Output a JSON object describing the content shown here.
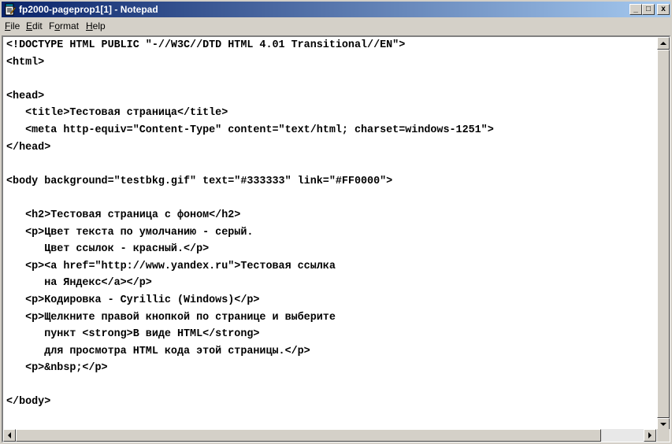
{
  "window": {
    "title": "fp2000-pageprop1[1] - Notepad",
    "caption_buttons": {
      "minimize": "_",
      "maximize": "□",
      "close": "x"
    }
  },
  "menu": [
    {
      "label": "File",
      "accel": "F",
      "rest": "ile"
    },
    {
      "label": "Edit",
      "accel": "E",
      "rest": "dit"
    },
    {
      "label": "Format",
      "accel": "o",
      "pre": "F",
      "rest": "rmat"
    },
    {
      "label": "Help",
      "accel": "H",
      "rest": "elp"
    }
  ],
  "editor": {
    "content": "<!DOCTYPE HTML PUBLIC \"-//W3C//DTD HTML 4.01 Transitional//EN\">\n<html>\n\n<head>\n   <title>Тестовая страница</title>\n   <meta http-equiv=\"Content-Type\" content=\"text/html; charset=windows-1251\">\n</head>\n\n<body background=\"testbkg.gif\" text=\"#333333\" link=\"#FF0000\">\n\n   <h2>Тестовая страница с фоном</h2>\n   <p>Цвет текста по умолчанию - серый.\n      Цвет ссылок - красный.</p>\n   <p><a href=\"http://www.yandex.ru\">Тестовая ссылка\n      на Яндекс</a></p>\n   <p>Кодировка - Cyrillic (Windows)</p>\n   <p>Щелкните правой кнопкой по странице и выберите\n      пункт <strong>В виде HTML</strong>\n      для просмотра HTML кода этой страницы.</p>\n   <p>&nbsp;</p>\n\n</body>\n\n</html>"
  },
  "colors": {
    "title_start": "#0a246a",
    "title_end": "#a6caf0",
    "chrome": "#d4d0c8",
    "editor_bg": "#ffffff"
  },
  "icons": {
    "app": "notepad-icon",
    "scroll_up": "arrow-up-icon",
    "scroll_down": "arrow-down-icon",
    "scroll_left": "arrow-left-icon",
    "scroll_right": "arrow-right-icon"
  }
}
